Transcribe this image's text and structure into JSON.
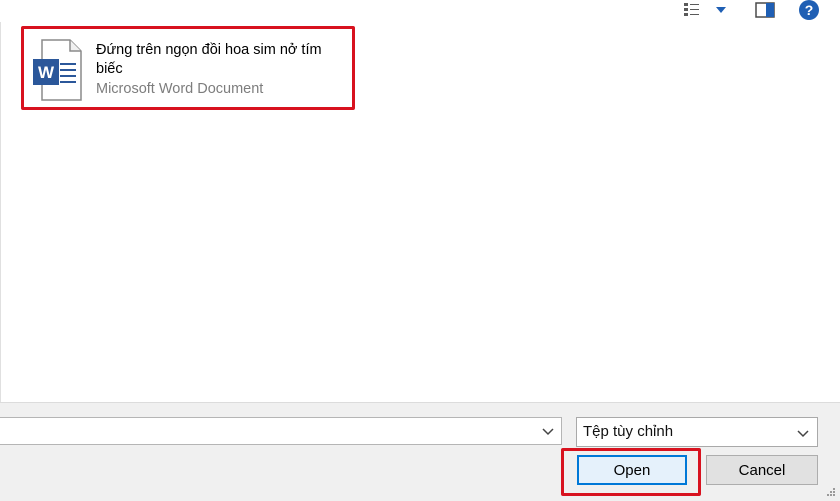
{
  "toolbar": {
    "icons": [
      "view-options-icon",
      "dropdown-arrow-icon",
      "preview-pane-icon",
      "help-icon"
    ],
    "help_label": "?"
  },
  "file": {
    "name": "Đứng trên ngọn đồi hoa sim nở tím biếc",
    "type": "Microsoft Word Document",
    "icon": "word-document-icon",
    "brand_color": "#2b579a"
  },
  "bottom": {
    "filename_value": "",
    "filetype_selected": "Tệp tùy chỉnh",
    "open_label": "Open",
    "cancel_label": "Cancel"
  },
  "colors": {
    "highlight": "#d8121f",
    "accent": "#0078d7"
  }
}
